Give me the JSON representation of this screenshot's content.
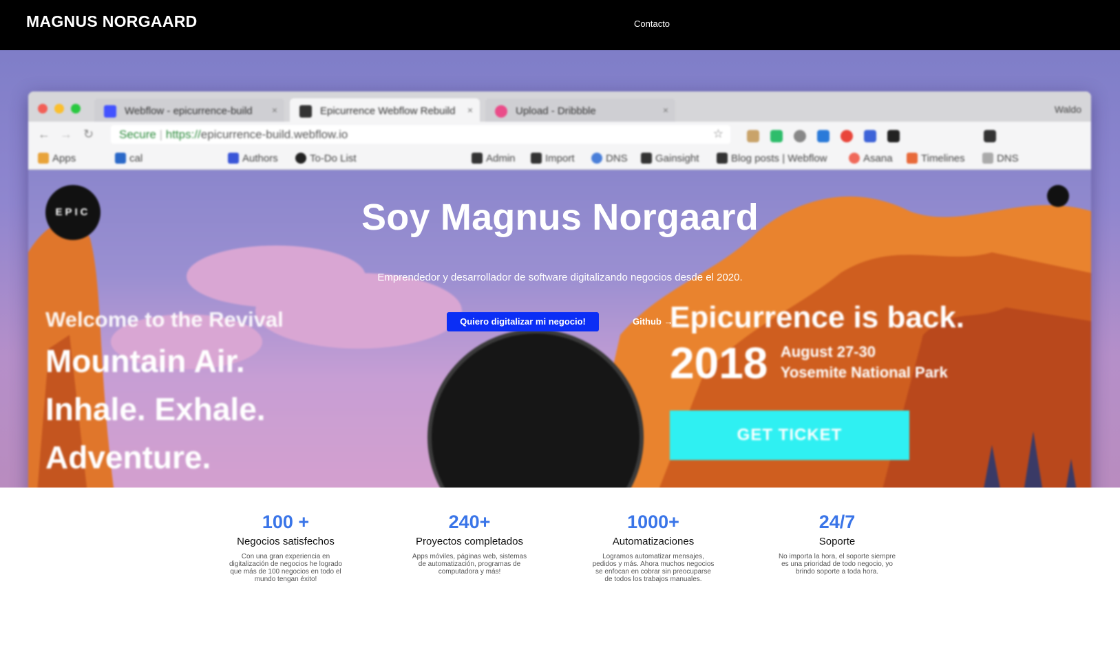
{
  "nav": {
    "brand": "MAGNUS NORGAARD",
    "link": "Contacto"
  },
  "hero": {
    "title": "Soy Magnus Norgaard",
    "subtitle": "Emprendedor y desarrollador de software digitalizando negocios desde el 2020.",
    "cta_primary": "Quiero digitalizar mi negocio!",
    "cta_secondary": "Github →"
  },
  "background_browser": {
    "tabs": [
      "Webflow - epicurrence-build",
      "Epicurrence Webflow Rebuild",
      "Upload - Dribbble"
    ],
    "user": "Waldo",
    "secure_label": "Secure",
    "url_protocol": "https://",
    "url_rest": "epicurrence-build.webflow.io",
    "bookmarks": [
      "Apps",
      "cal",
      "Authors",
      "To-Do List",
      "Admin",
      "Import",
      "DNS",
      "Gainsight",
      "Blog posts | Webflow",
      "Asana",
      "Timelines",
      "DNS"
    ],
    "site": {
      "logo": "EPIC",
      "welcome": "Welcome to the Revival",
      "lines": [
        "Mountain Air.",
        "Inhale. Exhale.",
        "Adventure."
      ],
      "back": "Epicurrence is back.",
      "year": "2018",
      "date": "August 27-30",
      "place": "Yosemite National Park",
      "ticket": "GET TICKET"
    }
  },
  "stats": [
    {
      "number": "100 +",
      "label": "Negocios satisfechos",
      "desc": "Con una gran experiencia en digitalización de negocios he logrado que más de 100 negocios en todo el mundo tengan éxito!"
    },
    {
      "number": "240+",
      "label": "Proyectos completados",
      "desc": "Apps móviles, páginas web, sistemas de automatización, programas de computadora y más!"
    },
    {
      "number": "1000+",
      "label": "Automatizaciones",
      "desc": "Logramos automatizar mensajes, pedidos y más. Ahora muchos negocios se enfocan en cobrar sin preocuparse de todos los trabajos manuales."
    },
    {
      "number": "24/7",
      "label": "Soporte",
      "desc": "No importa la hora, el soporte siempre es una prioridad de todo negocio, yo brindo soporte a toda hora."
    }
  ],
  "colors": {
    "accent": "#3a75e8",
    "cta": "#0b2ef5",
    "ticket": "#2ff0f2",
    "nav_bg": "#000000"
  }
}
